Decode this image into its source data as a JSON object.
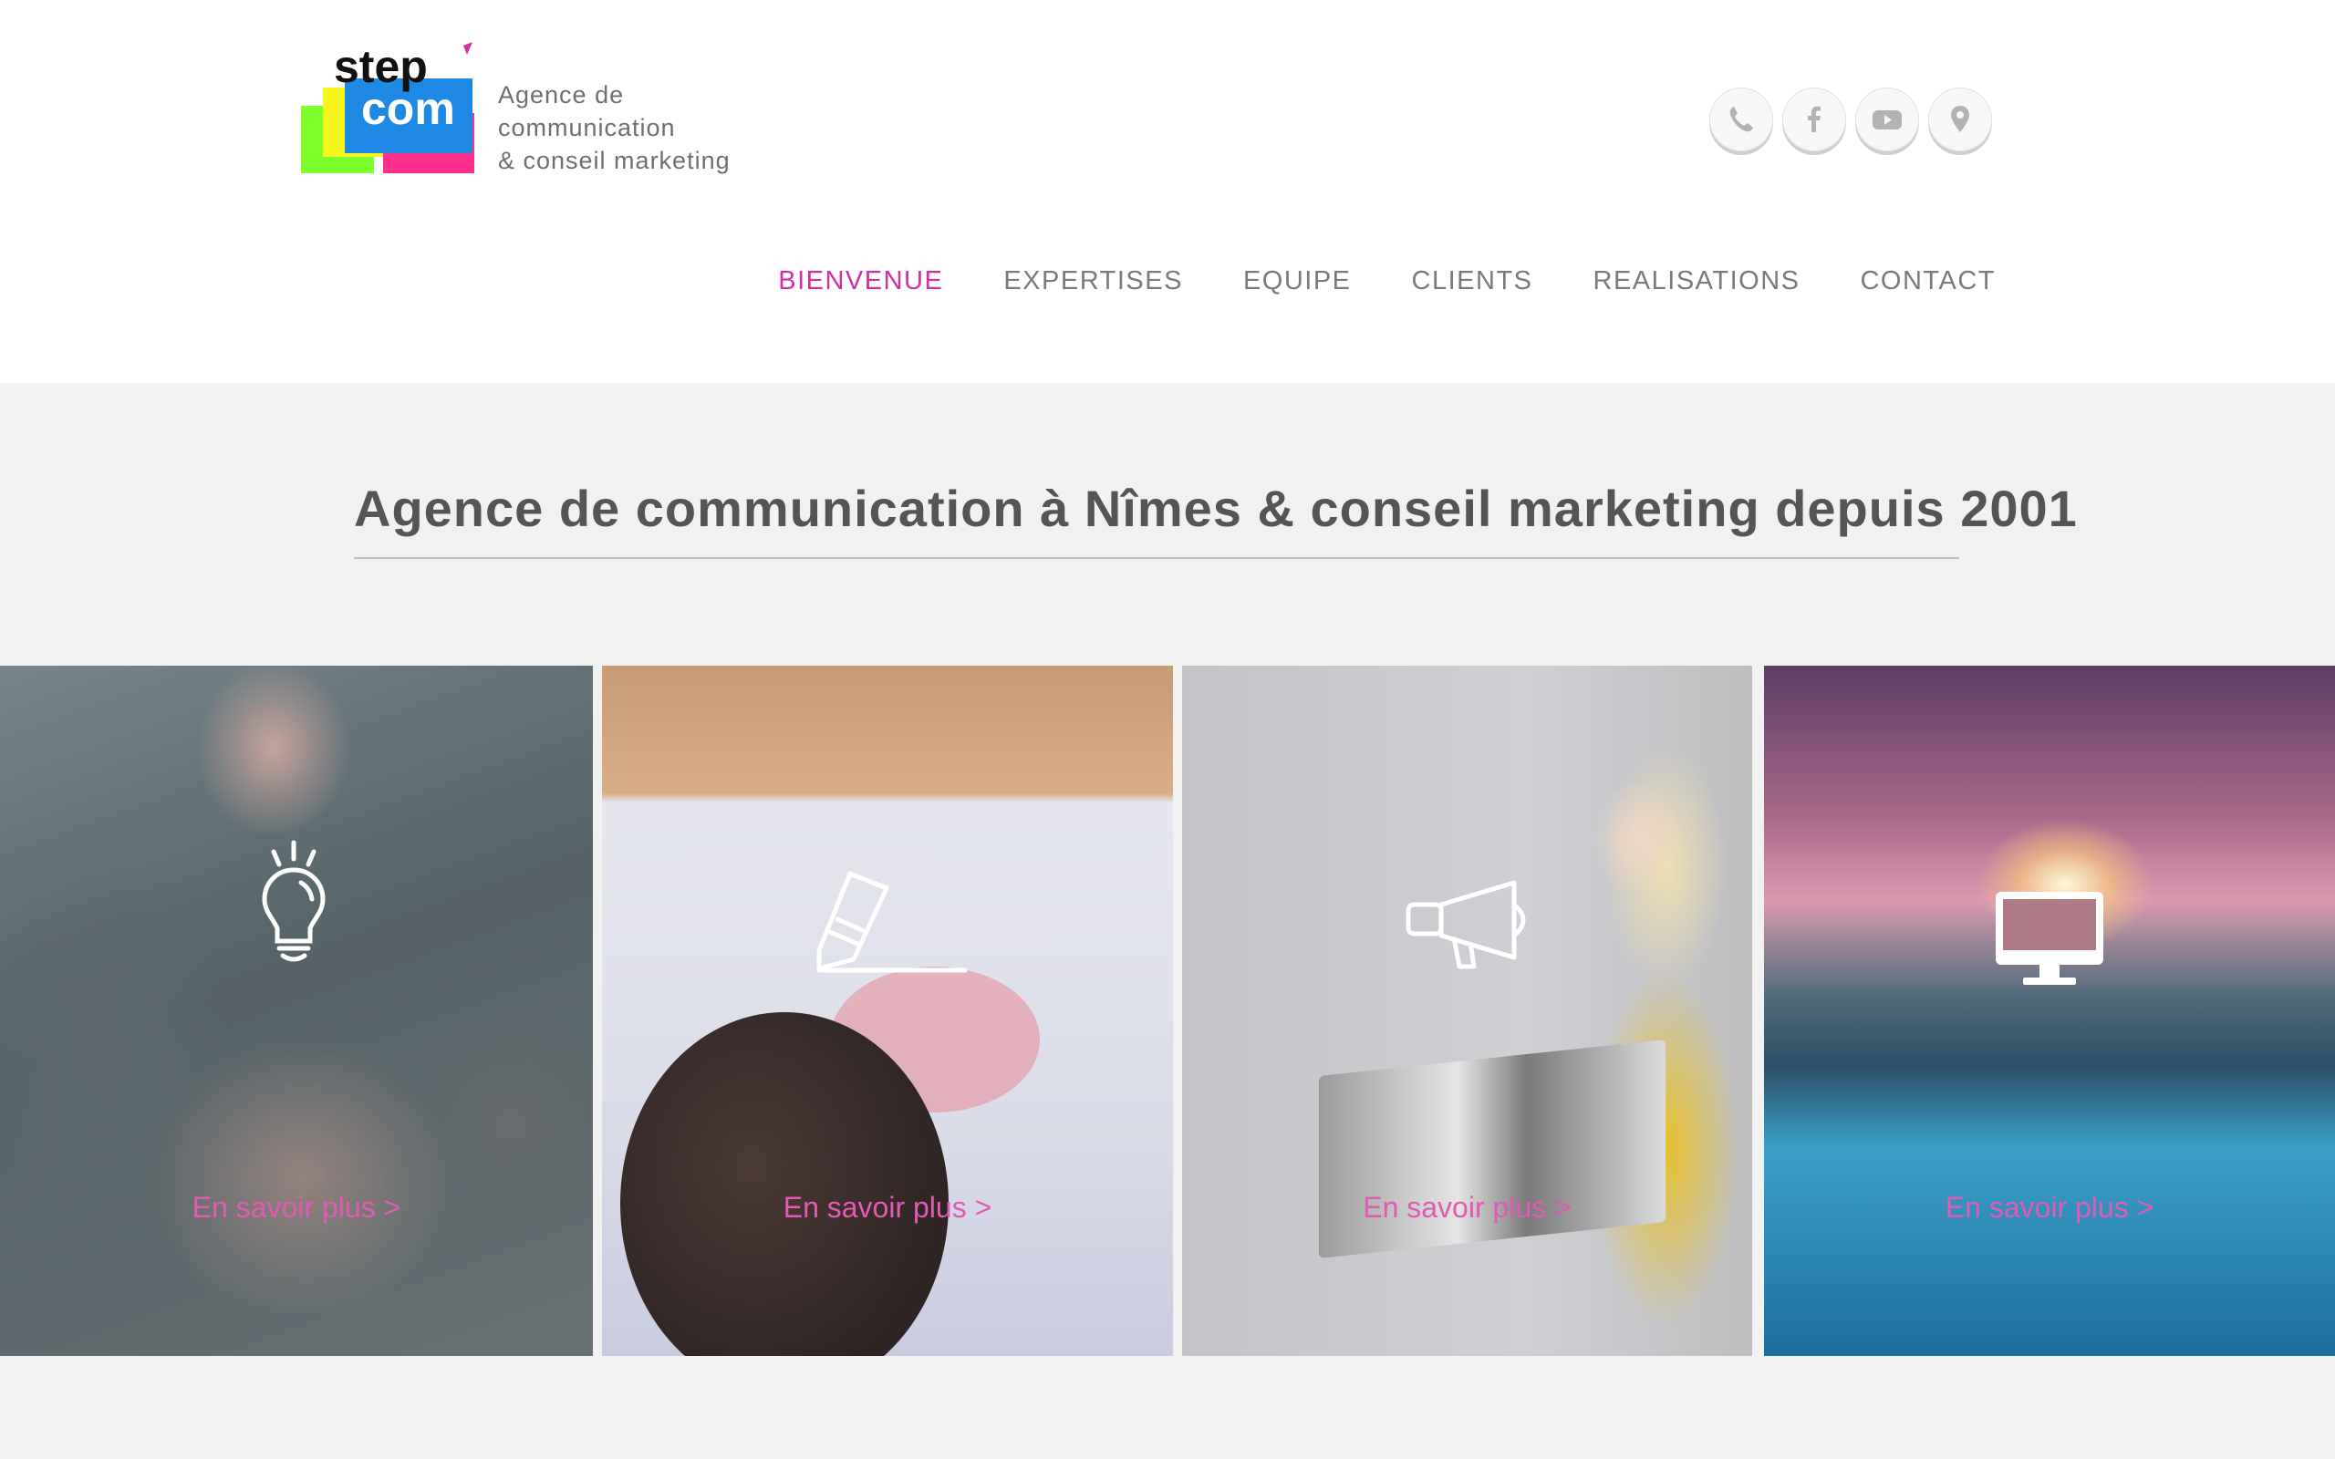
{
  "brand": {
    "logo_text_top": "step",
    "logo_text_bottom": "com",
    "tagline": [
      "Agence de",
      "communication",
      "& conseil marketing"
    ],
    "colors": {
      "accent": "#d42ea6",
      "link": "#e25ab4",
      "logo_blue": "#1e88e5",
      "logo_green": "#7dff2b",
      "logo_yellow": "#f6f61e",
      "logo_pink": "#ff2e8a"
    }
  },
  "social": [
    {
      "icon": "phone-icon"
    },
    {
      "icon": "facebook-icon"
    },
    {
      "icon": "youtube-icon"
    },
    {
      "icon": "map-pin-icon"
    }
  ],
  "nav": {
    "items": [
      {
        "label": "BIENVENUE",
        "active": true
      },
      {
        "label": "EXPERTISES",
        "active": false
      },
      {
        "label": "EQUIPE",
        "active": false
      },
      {
        "label": "CLIENTS",
        "active": false
      },
      {
        "label": "REALISATIONS",
        "active": false
      },
      {
        "label": "CONTACT",
        "active": false
      }
    ]
  },
  "headline": "Agence de communication à Nîmes & conseil marketing depuis 2001",
  "panels": [
    {
      "icon": "lightbulb-icon",
      "link": "En savoir plus >"
    },
    {
      "icon": "pencil-icon",
      "link": "En savoir plus >"
    },
    {
      "icon": "megaphone-icon",
      "link": "En savoir plus >"
    },
    {
      "icon": "monitor-icon",
      "link": "En savoir plus >"
    }
  ]
}
